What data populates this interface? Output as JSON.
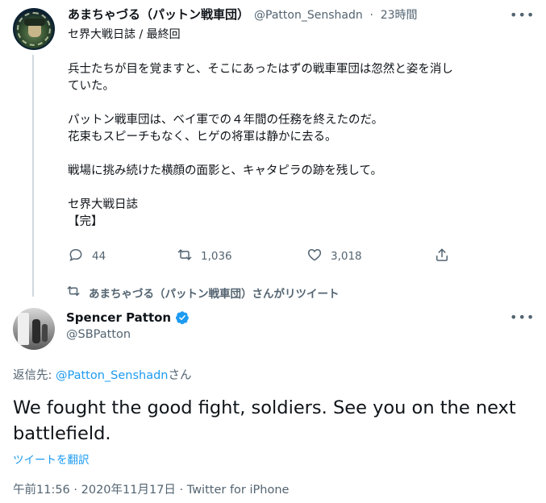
{
  "parent_tweet": {
    "display_name": "あまちゃづる（パットン戦車団）",
    "handle": "@Patton_Senshadn",
    "separator": "·",
    "time": "23時間",
    "subtitle": "セ界大戦日誌 / 最終回",
    "body_lines": [
      "兵士たちが目を覚ますと、そこにあったはずの戦車軍団は忽然と姿を消し",
      "ていた。",
      "",
      "パットン戦車団は、ベイ軍での４年間の任務を終えたのだ。",
      "花束もスピーチもなく、ヒゲの将軍は静かに去る。",
      "",
      "戦場に挑み続けた横顔の面影と、キャタピラの跡を残して。",
      "",
      "セ界大戦日誌",
      "【完】"
    ],
    "more_icon": "ellipsis-icon",
    "actions": {
      "replies": "44",
      "retweets": "1,036",
      "likes": "3,018"
    }
  },
  "retweet_banner": {
    "icon": "retweet-icon",
    "text": "あまちゃづる（パットン戦車団）さんがリツイート"
  },
  "main_tweet": {
    "display_name": "Spencer Patton",
    "verified": true,
    "handle": "@SBPatton",
    "reply_prefix": "返信先:",
    "reply_mention": "@Patton_Senshadn",
    "reply_suffix": "さん",
    "text": "We fought the good fight, soldiers. See you on the next battlefield.",
    "translate_label": "ツイートを翻訳",
    "timestamp": "午前11:56 · 2020年11月17日 · Twitter for iPhone"
  },
  "colors": {
    "text_primary": "#0f1419",
    "text_secondary": "#536471",
    "accent": "#1d9bf0",
    "divider": "#cfd9de"
  }
}
